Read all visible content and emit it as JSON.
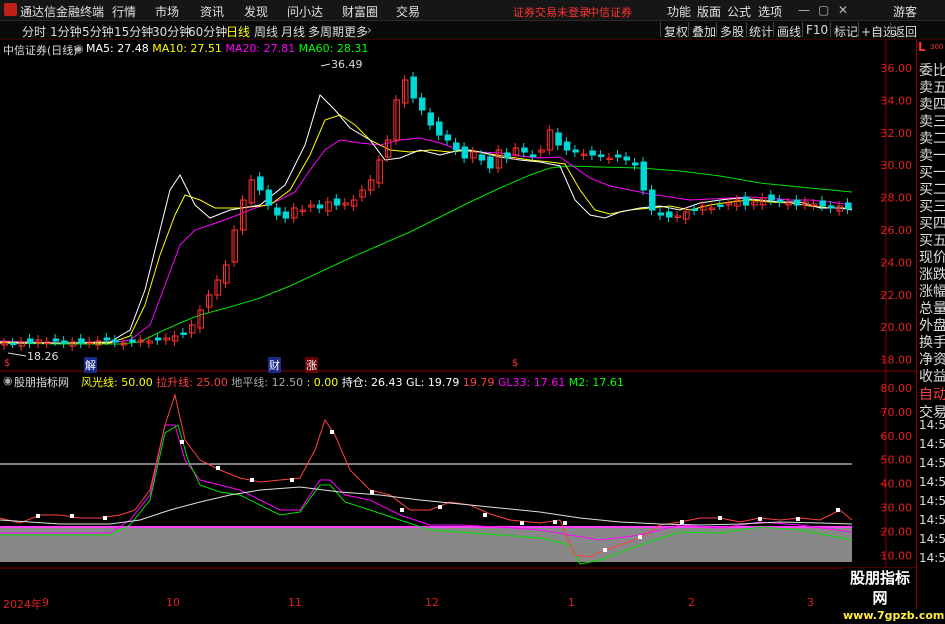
{
  "window": {
    "app_title": "通达信金融终端",
    "menu": [
      "行情",
      "市场",
      "资讯",
      "发现",
      "问小达",
      "财富圈",
      "交易"
    ],
    "warnings": [
      "证券交易未登录",
      "中信证券"
    ],
    "right_menu": [
      "功能",
      "版面",
      "公式",
      "选项"
    ],
    "user": "游客"
  },
  "toolbar": {
    "periods": [
      "分时",
      "1分钟",
      "5分钟",
      "15分钟",
      "30分钟",
      "60分钟",
      "日线",
      "周线",
      "月线",
      "多周期"
    ],
    "more": "更多",
    "active_period": "日线",
    "buttons": [
      "复权",
      "叠加",
      "多股",
      "统计",
      "画线",
      "F10",
      "标记",
      "+自选",
      "返回"
    ]
  },
  "right_panel": {
    "badge": "L",
    "badge_sub": "300",
    "labels": [
      "委比",
      "卖五",
      "卖四",
      "卖三",
      "卖二",
      "卖一",
      "买一",
      "买二",
      "买三",
      "买四",
      "买五",
      "现价",
      "涨跌",
      "涨幅",
      "总量",
      "外盘",
      "换手",
      "净资",
      "收益"
    ],
    "lower_labels": [
      "自动",
      "交易"
    ],
    "time_ticks": [
      "14:56",
      "14:56",
      "14:56",
      "14:56",
      "14:56",
      "14:56",
      "14:56",
      "14:56"
    ]
  },
  "main_chart": {
    "stock": "中信证券(日线)",
    "legend": [
      {
        "label": "MA5: 27.48",
        "color": "#ffffff"
      },
      {
        "label": "MA10: 27.51",
        "color": "#ffff00"
      },
      {
        "label": "MA20: 27.81",
        "color": "#ff00ff"
      },
      {
        "label": "MA60: 28.31",
        "color": "#00ff00"
      }
    ],
    "y_ticks": [
      "36.00",
      "34.00",
      "32.00",
      "30.00",
      "28.00",
      "26.00",
      "24.00",
      "22.00",
      "20.00",
      "18.00"
    ],
    "high_label": "36.49",
    "low_label": "18.26",
    "markers": [
      {
        "text": "解",
        "color": "#4a7dff"
      },
      {
        "text": "财",
        "color": "#4a7dff"
      },
      {
        "text": "涨",
        "color": "#ff3333"
      }
    ]
  },
  "indicator": {
    "name": "股朋指标网",
    "legend": [
      {
        "label": "风光线: 50.00",
        "color": "#ffff00"
      },
      {
        "label": "拉升线: 25.00",
        "color": "#ff4040"
      },
      {
        "label": "地平线: 12.50",
        "color": "#aaaaaa"
      },
      {
        "label": ": 0.00",
        "color": "#ffff00"
      },
      {
        "label": "持仓: 26.43",
        "color": "#ffffff"
      },
      {
        "label": "GL: 19.79",
        "color": "#ffffff"
      },
      {
        "label": "19.79",
        "color": "#ff4040"
      },
      {
        "label": "GL33: 17.61",
        "color": "#ff00ff"
      },
      {
        "label": "M2: 17.61",
        "color": "#00ff00"
      }
    ],
    "y_ticks": [
      "80.00",
      "70.00",
      "60.00",
      "50.00",
      "40.00",
      "30.00",
      "20.00",
      "10.00"
    ]
  },
  "time_axis": [
    "2024年",
    "9",
    "10",
    "11",
    "12",
    "1",
    "2",
    "3"
  ],
  "watermark": {
    "line1": "股朋指标网",
    "line2": "www.7gpzb.com"
  },
  "chart_data": [
    {
      "type": "candlestick",
      "title": "中信证券(日线)",
      "ylim": [
        17.5,
        37.0
      ],
      "series": [
        {
          "name": "MA5",
          "values": [
            27.48
          ]
        },
        {
          "name": "MA10",
          "values": [
            27.51
          ]
        },
        {
          "name": "MA20",
          "values": [
            27.81
          ]
        },
        {
          "name": "MA60",
          "values": [
            28.31
          ]
        }
      ],
      "annotations": {
        "high": 36.49,
        "low": 18.26
      },
      "grid": false
    },
    {
      "type": "line",
      "title": "股朋指标网",
      "ylim": [
        5,
        82
      ],
      "reference_lines": {
        "风光线": 50.0,
        "拉升线": 25.0,
        "地平线": 12.5
      },
      "series": [
        {
          "name": "持仓",
          "values": [
            26.43
          ]
        },
        {
          "name": "GL",
          "values": [
            19.79
          ]
        },
        {
          "name": "GL33",
          "values": [
            17.61
          ]
        },
        {
          "name": "M2",
          "values": [
            17.61
          ]
        }
      ],
      "grid": false
    }
  ]
}
